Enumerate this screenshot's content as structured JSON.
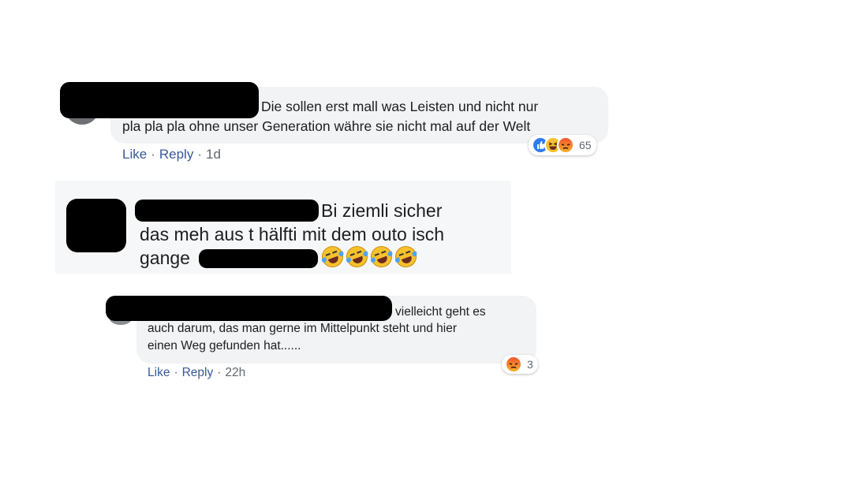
{
  "comment1": {
    "text_line1": "Die sollen erst mall was Leisten und nicht nur",
    "text_line2": "pla pla pla ohne unser Generation währe sie nicht mal auf der Welt",
    "like": "Like",
    "reply": "Reply",
    "sep": "·",
    "time": "1d",
    "reaction_count": "65",
    "reactions": [
      "like-icon",
      "haha-icon",
      "angry-icon"
    ]
  },
  "comment2": {
    "text_line1": "Bi ziemli sicher",
    "text_line2": "das meh aus t hälfti mit dem outo isch",
    "text_line3": "gange",
    "emojis": [
      "rofl-emoji",
      "rofl-emoji",
      "rofl-emoji",
      "rofl-emoji"
    ]
  },
  "comment3": {
    "text_line1": "vielleicht geht es",
    "text_line2": "auch darum, das man gerne im Mittelpunkt steht und hier",
    "text_line3": "einen Weg gefunden hat......",
    "like": "Like",
    "reply": "Reply",
    "sep": "·",
    "time": "22h",
    "reaction_count": "3",
    "reactions": [
      "angry-icon"
    ]
  },
  "colors": {
    "bubble": "#f2f3f5",
    "link": "#385898",
    "meta": "#606770",
    "like_blue": "#2d7af6",
    "redaction": "#000000"
  }
}
